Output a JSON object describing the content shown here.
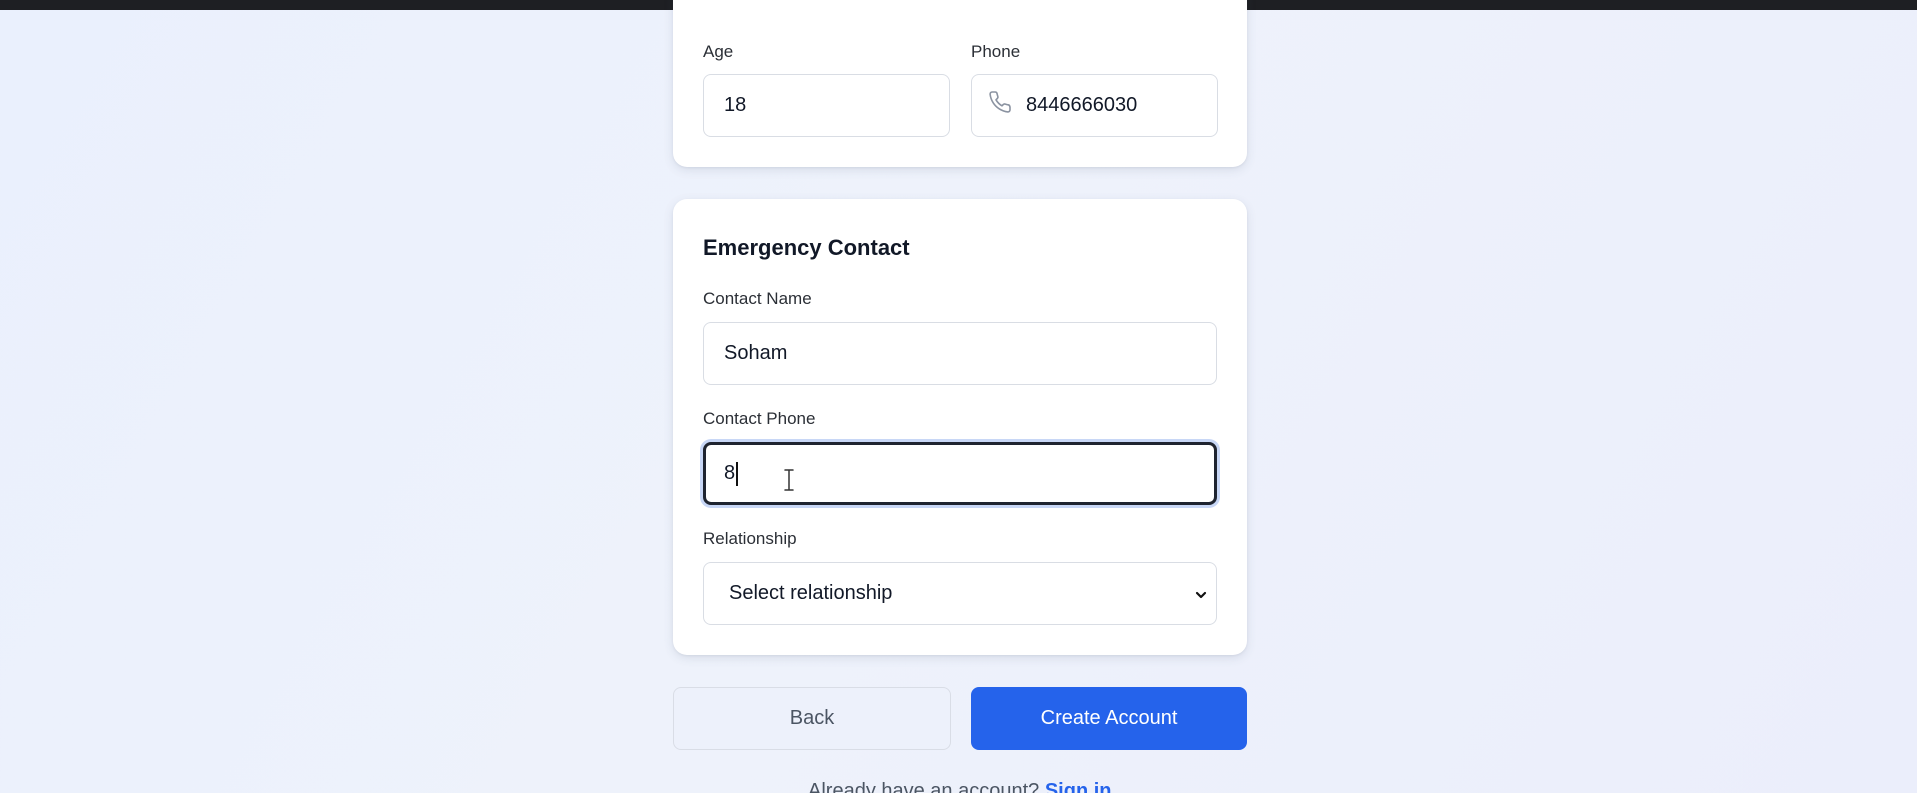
{
  "personal": {
    "age_label": "Age",
    "age_value": "18",
    "phone_label": "Phone",
    "phone_value": "8446666030"
  },
  "emergency": {
    "title": "Emergency Contact",
    "contact_name_label": "Contact Name",
    "contact_name_value": "Soham",
    "contact_phone_label": "Contact Phone",
    "contact_phone_value": "8",
    "relationship_label": "Relationship",
    "relationship_selected": "Select relationship"
  },
  "actions": {
    "back_label": "Back",
    "create_label": "Create Account"
  },
  "footer": {
    "prompt": "Already have an account? ",
    "signin_label": "Sign in"
  },
  "colors": {
    "primary": "#2563eb",
    "page_bg": "#eaf0fd",
    "topbar": "#1e1f23"
  },
  "icons": {
    "phone": "phone-icon",
    "select": "chevron-down-icon",
    "cursor": "text-cursor-icon"
  }
}
